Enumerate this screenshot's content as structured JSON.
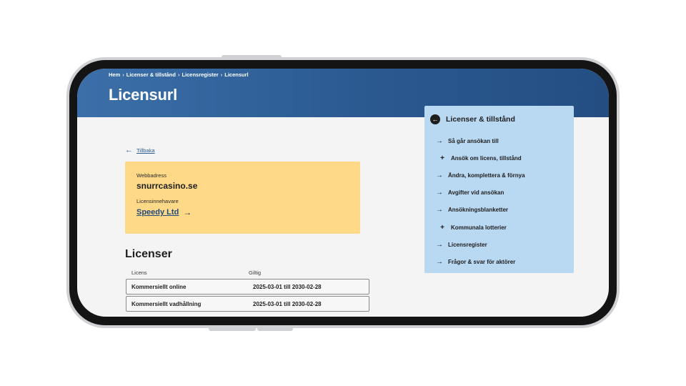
{
  "breadcrumb": [
    "Hem",
    "Licenser & tillstånd",
    "Licensregister",
    "Licensurl"
  ],
  "page": {
    "title": "Licensurl"
  },
  "back": {
    "label": "Tillbaka",
    "icon": "arrow-left-icon"
  },
  "info_card": {
    "address_label": "Webbadress",
    "address_value": "snurrcasino.se",
    "holder_label": "Licensinnehavare",
    "holder_value": "Speedy Ltd",
    "holder_icon": "arrow-right-icon",
    "background": "#fdd988"
  },
  "licenses": {
    "title": "Licenser",
    "columns": [
      "Licens",
      "Giltig"
    ],
    "rows": [
      {
        "name": "Kommersiellt online",
        "valid": "2025-03-01 till 2030-02-28"
      },
      {
        "name": "Kommersiellt vadhållning",
        "valid": "2025-03-01 till 2030-02-28"
      }
    ]
  },
  "side_nav": {
    "title": "Licenser & tillstånd",
    "title_icon": "back-circle-icon",
    "background": "#b9d8f2",
    "items": [
      {
        "label": "Så går ansökan till",
        "icon": "arrow-right-icon"
      },
      {
        "label": "Ansök om licens, tillstånd",
        "icon": "plus-icon"
      },
      {
        "label": "Ändra, komplettera & förnya",
        "icon": "arrow-right-icon"
      },
      {
        "label": "Avgifter vid ansökan",
        "icon": "arrow-right-icon"
      },
      {
        "label": "Ansökningsblanketter",
        "icon": "arrow-right-icon"
      },
      {
        "label": "Kommunala lotterier",
        "icon": "plus-icon"
      },
      {
        "label": "Licensregister",
        "icon": "arrow-right-icon"
      },
      {
        "label": "Frågor & svar för aktörer",
        "icon": "arrow-right-icon"
      }
    ]
  },
  "colors": {
    "header": "#2a5990",
    "link": "#2d5d95"
  }
}
